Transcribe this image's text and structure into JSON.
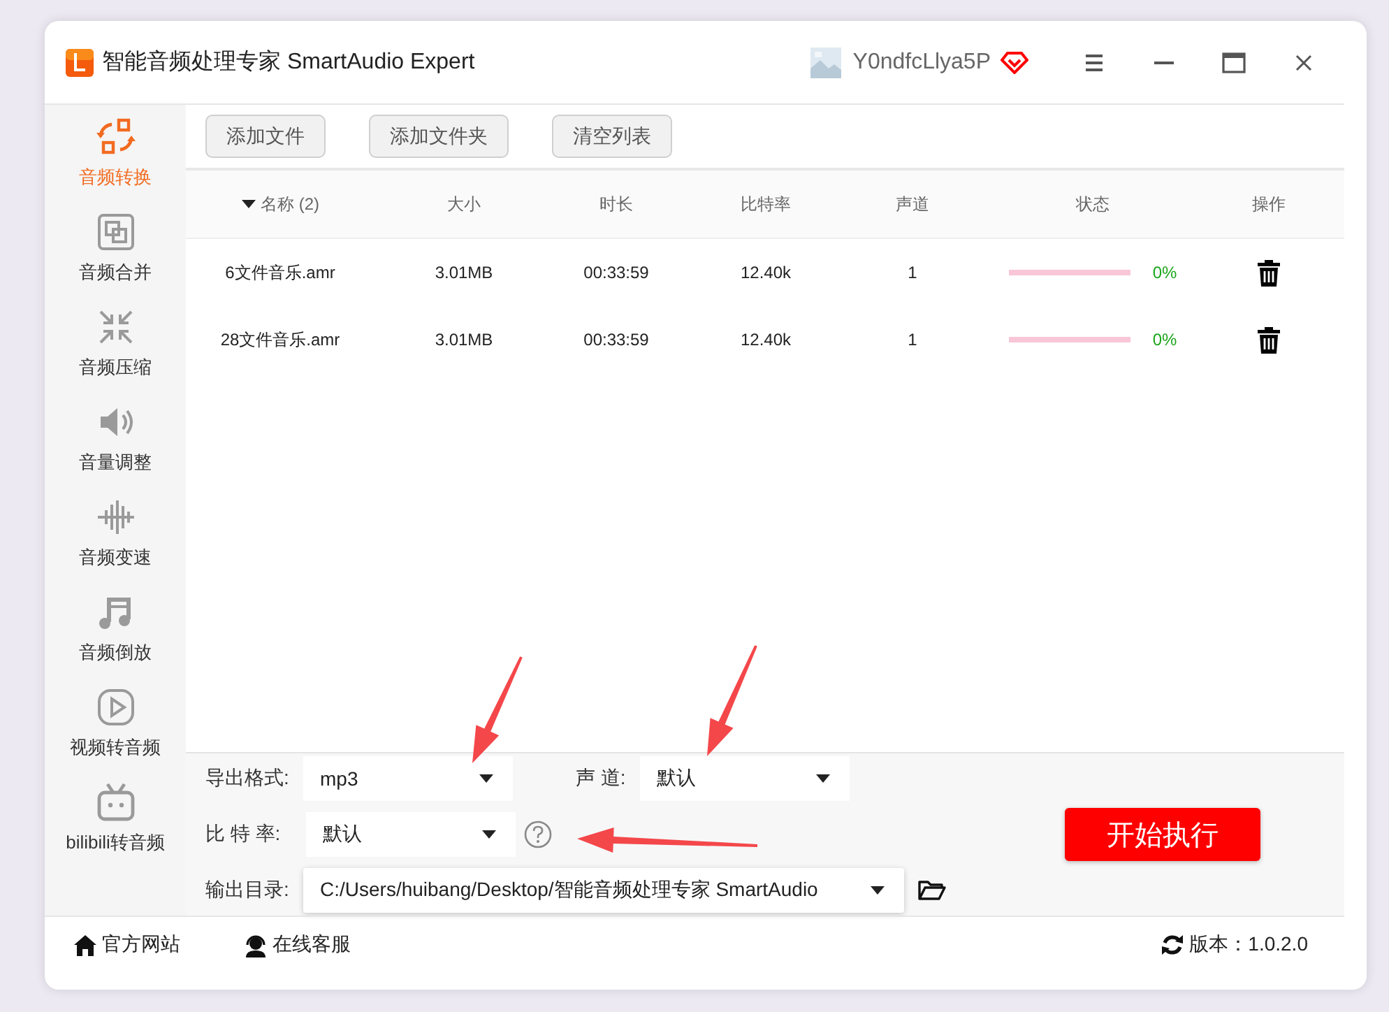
{
  "window": {
    "title": "智能音频处理专家 SmartAudio Expert",
    "user": "Y0ndfcLlya5P"
  },
  "sidebar": {
    "items": [
      {
        "label": "音频转换",
        "selected": true
      },
      {
        "label": "音频合并",
        "selected": false
      },
      {
        "label": "音频压缩",
        "selected": false
      },
      {
        "label": "音量调整",
        "selected": false
      },
      {
        "label": "音频变速",
        "selected": false
      },
      {
        "label": "音频倒放",
        "selected": false
      },
      {
        "label": "视频转音频",
        "selected": false
      },
      {
        "label": "bilibili转音频",
        "selected": false
      }
    ]
  },
  "toolbar": {
    "buttons": [
      "添加文件",
      "添加文件夹",
      "清空列表"
    ]
  },
  "table": {
    "columns": [
      {
        "label": "名称 (2)",
        "sorted": true
      },
      {
        "label": "大小",
        "sorted": false
      },
      {
        "label": "时长",
        "sorted": false
      },
      {
        "label": "比特率",
        "sorted": false
      },
      {
        "label": "声道",
        "sorted": false
      },
      {
        "label": "状态",
        "sorted": false
      },
      {
        "label": "操作",
        "sorted": false
      }
    ],
    "rows": [
      {
        "name": "6文件音乐.amr",
        "size": "3.01MB",
        "duration": "00:33:59",
        "bitrate": "12.40k",
        "channels": "1",
        "level": 0,
        "status": "0%"
      },
      {
        "name": "28文件音乐.amr",
        "size": "3.01MB",
        "duration": "00:33:59",
        "bitrate": "12.40k",
        "channels": "1",
        "level": 0,
        "status": "0%"
      }
    ]
  },
  "settings": {
    "format": {
      "label": "导出格式:",
      "value": "mp3"
    },
    "channel": {
      "label": "声 道:",
      "value": "默认"
    },
    "bitrate": {
      "label": "比 特 率:",
      "value": "默认"
    },
    "output_dir": {
      "label": "输出目录:",
      "value": "C:/Users/huibang/Desktop/智能音频处理专家 SmartAudio"
    },
    "start_button": "开始执行"
  },
  "footer": {
    "links": [
      "官方网站",
      "在线客服"
    ],
    "version": "版本：1.0.2.0"
  }
}
